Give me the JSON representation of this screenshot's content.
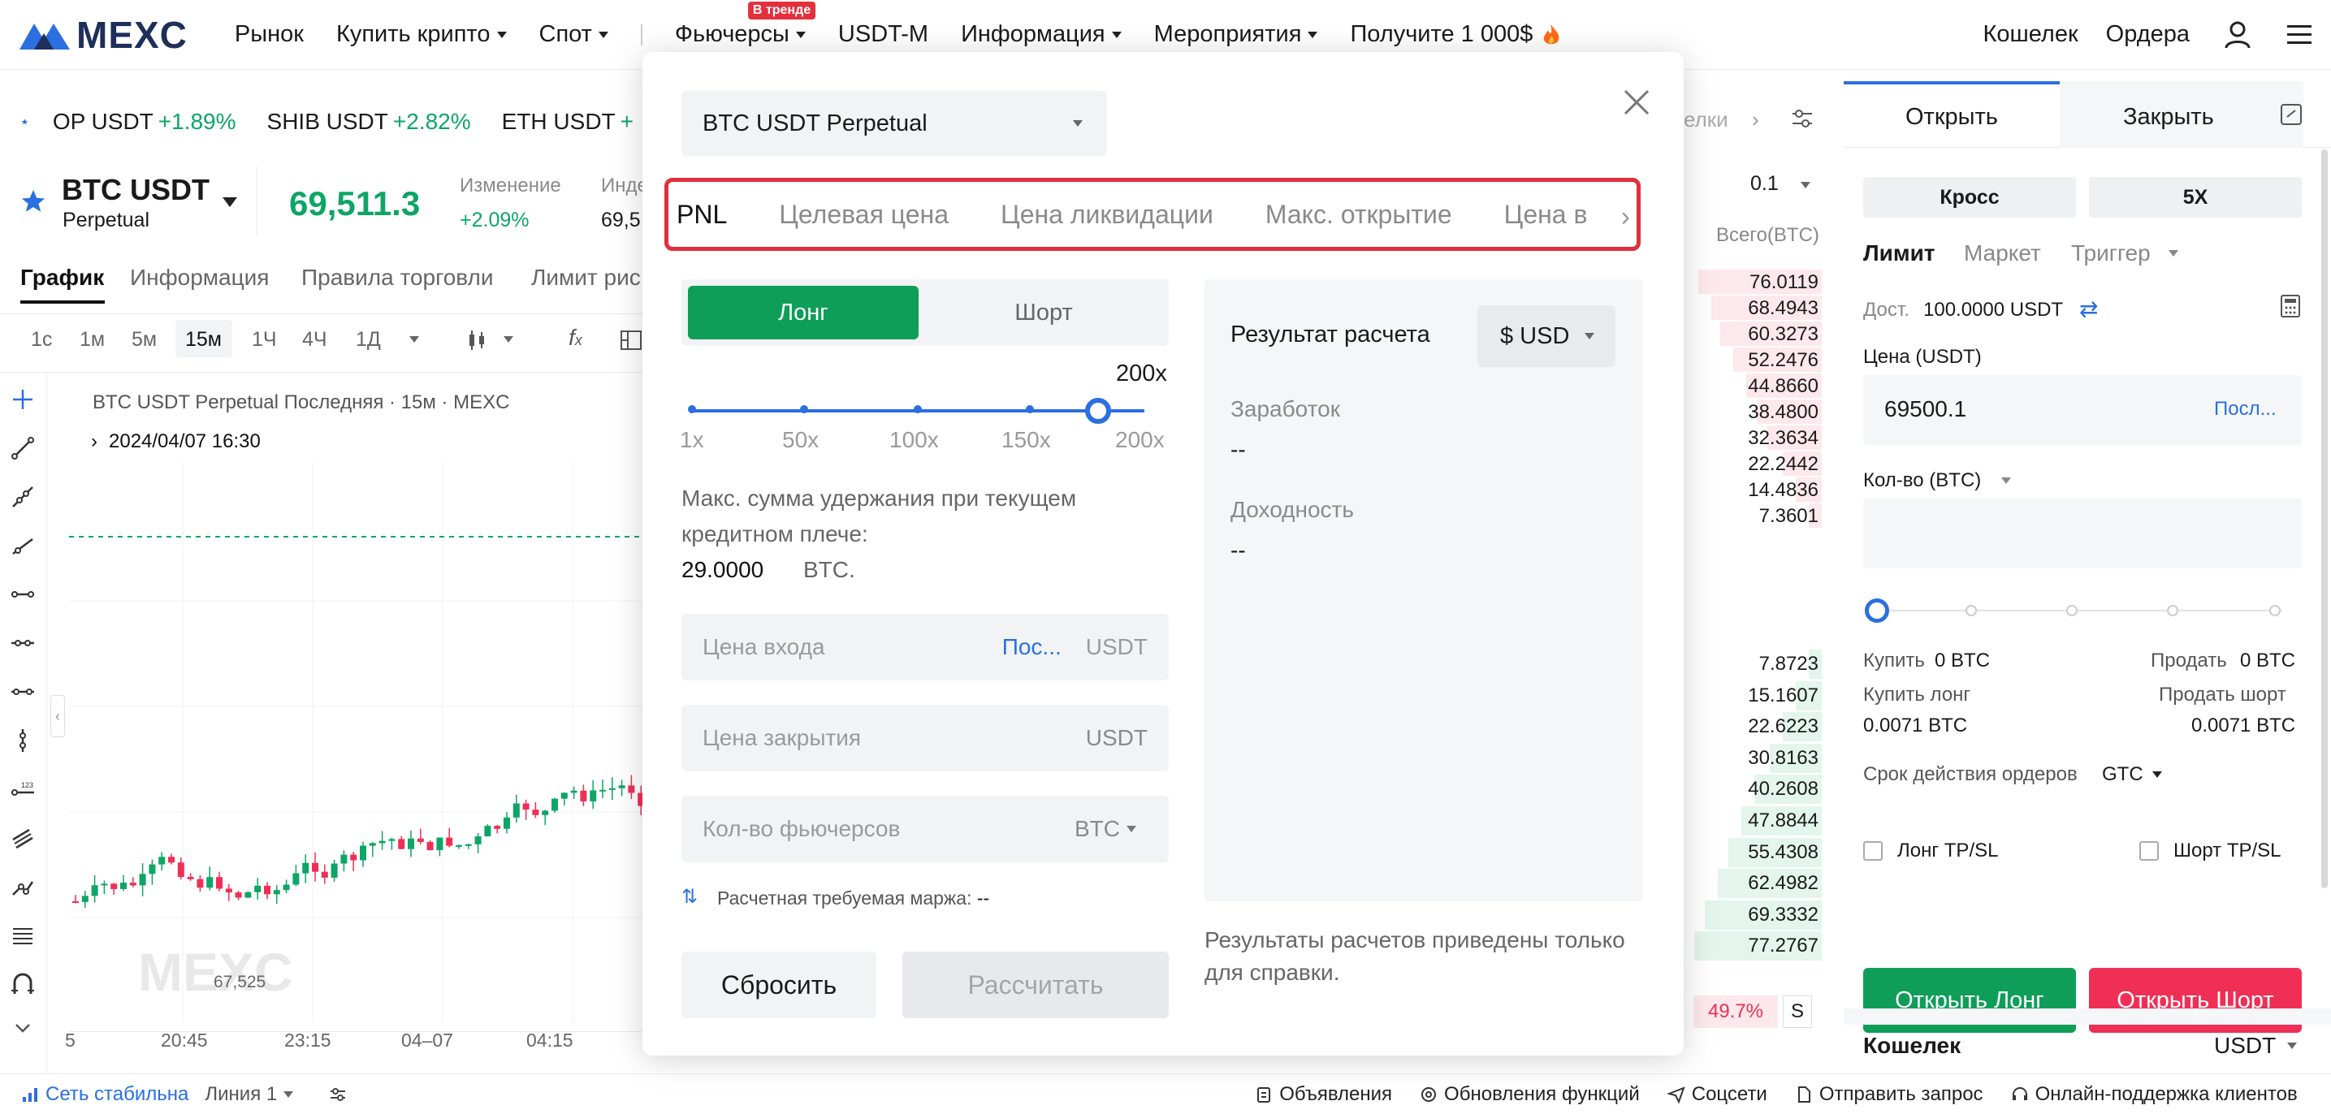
{
  "nav": {
    "logo": "MEXC",
    "items": [
      "Рынок",
      "Купить крипто",
      "Спот",
      "Фьючерсы",
      "USDT-M",
      "Информация",
      "Мероприятия",
      "Получите 1 000$"
    ],
    "trend_badge": "В тренде",
    "right": [
      "Кошелек",
      "Ордера"
    ]
  },
  "ticker": [
    {
      "pair": "OP USDT",
      "change": "+1.89%"
    },
    {
      "pair": "SHIB USDT",
      "change": "+2.82%"
    },
    {
      "pair": "ETH USDT",
      "change": "+"
    }
  ],
  "instrument": {
    "symbol": "BTC USDT",
    "type": "Perpetual",
    "price": "69,511.3",
    "change_label": "Изменение",
    "change_value": "+2.09%",
    "index_label": "Индекс",
    "index_value": "69,5"
  },
  "chart_tabs": [
    "График",
    "Информация",
    "Правила торговли",
    "Лимит рис"
  ],
  "timeframes": [
    "1с",
    "1м",
    "5м",
    "15м",
    "1Ч",
    "4Ч",
    "1Д"
  ],
  "chart": {
    "legend": "BTC USDT Perpetual Последняя · 15м · MEXC",
    "date": "2024/04/07 16:30",
    "low_label": "67,525",
    "watermark": "MEXC",
    "x_ticks": [
      "5",
      "20:45",
      "23:15",
      "04–07",
      "04:15"
    ]
  },
  "modal": {
    "contract": "BTC USDT Perpetual",
    "tabs": [
      "PNL",
      "Целевая цена",
      "Цена ликвидации",
      "Макс. открытие",
      "Цена в"
    ],
    "long": "Лонг",
    "short": "Шорт",
    "leverage": "200x",
    "slider_labels": [
      "1x",
      "50x",
      "100x",
      "150x",
      "200x"
    ],
    "max_hold_text_1": "Макс. сумма удержания при текущем",
    "max_hold_text_2": "кредитном плече:",
    "max_hold_value": "29.0000",
    "max_hold_unit": "BTC.",
    "entry_price": "Цена входа",
    "entry_link": "Пос...",
    "entry_unit": "USDT",
    "close_price": "Цена закрытия",
    "close_unit": "USDT",
    "qty": "Кол-во фьючерсов",
    "qty_unit": "BTC",
    "margin_label": "Расчетная требуемая маржа:",
    "margin_value": "--",
    "reset": "Сбросить",
    "calculate": "Рассчитать",
    "result_title": "Результат расчета",
    "currency": "$ USD",
    "earnings_label": "Заработок",
    "earnings_value": "--",
    "yield_label": "Доходность",
    "yield_value": "--",
    "note_1": "Результаты расчетов приведены только",
    "note_2": "для справки."
  },
  "orderbook": {
    "partial_label": "елки",
    "step": "0.1",
    "total_header": "Всего(BTC)",
    "asks": [
      "76.0119",
      "68.4943",
      "60.3273",
      "52.2476",
      "44.8660",
      "38.4800",
      "32.3634",
      "22.2442",
      "14.4836",
      "7.3601"
    ],
    "bids": [
      "7.8723",
      "15.1607",
      "22.6223",
      "30.8163",
      "40.2608",
      "47.8844",
      "55.4308",
      "62.4982",
      "69.3332",
      "77.2767"
    ],
    "ratio": "49.7%",
    "side": "S",
    "ask_depth": [
      0.95,
      0.85,
      0.78,
      0.68,
      0.58,
      0.5,
      0.42,
      0.3,
      0.2,
      0.1
    ],
    "bid_depth": [
      0.1,
      0.2,
      0.3,
      0.4,
      0.52,
      0.62,
      0.72,
      0.8,
      0.9,
      0.98
    ]
  },
  "panel": {
    "tab_open": "Открыть",
    "tab_close": "Закрыть",
    "margin_mode": "Кросс",
    "leverage": "5X",
    "order_types": [
      "Лимит",
      "Маркет",
      "Триггер"
    ],
    "available_label": "Дост.",
    "available_value": "100.0000 USDT",
    "price_label": "Цена (USDT)",
    "price_value": "69500.1",
    "price_link": "Посл...",
    "qty_label": "Кол-во (BTC)",
    "buy_label": "Купить",
    "buy_value": "0 BTC",
    "sell_label": "Продать",
    "sell_value": "0 BTC",
    "buy_long_label": "Купить лонг",
    "buy_long_value": "0.0071 BTC",
    "sell_short_label": "Продать шорт",
    "sell_short_value": "0.0071 BTC",
    "tif_label": "Срок действия ордеров",
    "tif_value": "GTC",
    "long_tpsl": "Лонг TP/SL",
    "short_tpsl": "Шорт TP/SL",
    "open_long": "Открыть Лонг",
    "open_short": "Открыть Шорт",
    "wallet": "Кошелек",
    "wallet_currency": "USDT"
  },
  "status": {
    "network": "Сеть стабильна",
    "line": "Линия 1",
    "items": [
      "Объявления",
      "Обновления функций",
      "Соцсети",
      "Отправить запрос",
      "Онлайн-поддержка клиентов"
    ]
  },
  "colors": {
    "green": "#0e9e58",
    "red": "#ef2f55",
    "blue": "#2b6fe0",
    "highlight": "#e0303c"
  }
}
